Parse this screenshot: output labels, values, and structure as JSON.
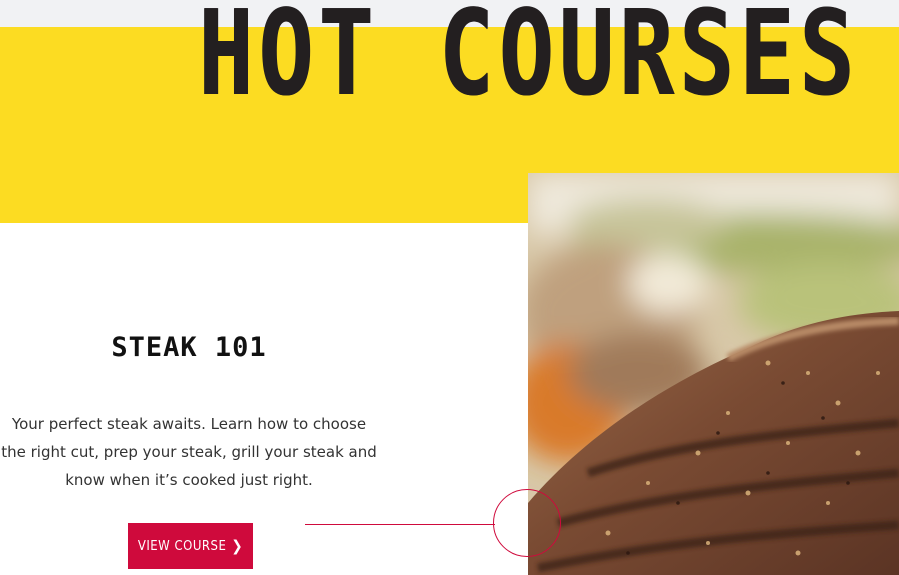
{
  "hero": {
    "title": "HOT COURSES"
  },
  "course": {
    "title": "STEAK 101",
    "description": "Your perfect steak awaits. Learn how to choose the right cut, prep your steak, grill your steak and know when it’s cooked just right.",
    "cta_label": "VIEW COURSE",
    "cta_icon": "chevron-right-icon",
    "image_subject": "grilled steak"
  },
  "colors": {
    "accent_yellow": "#fcdc22",
    "accent_red": "#cf0a3c",
    "title_dark": "#231f20"
  }
}
